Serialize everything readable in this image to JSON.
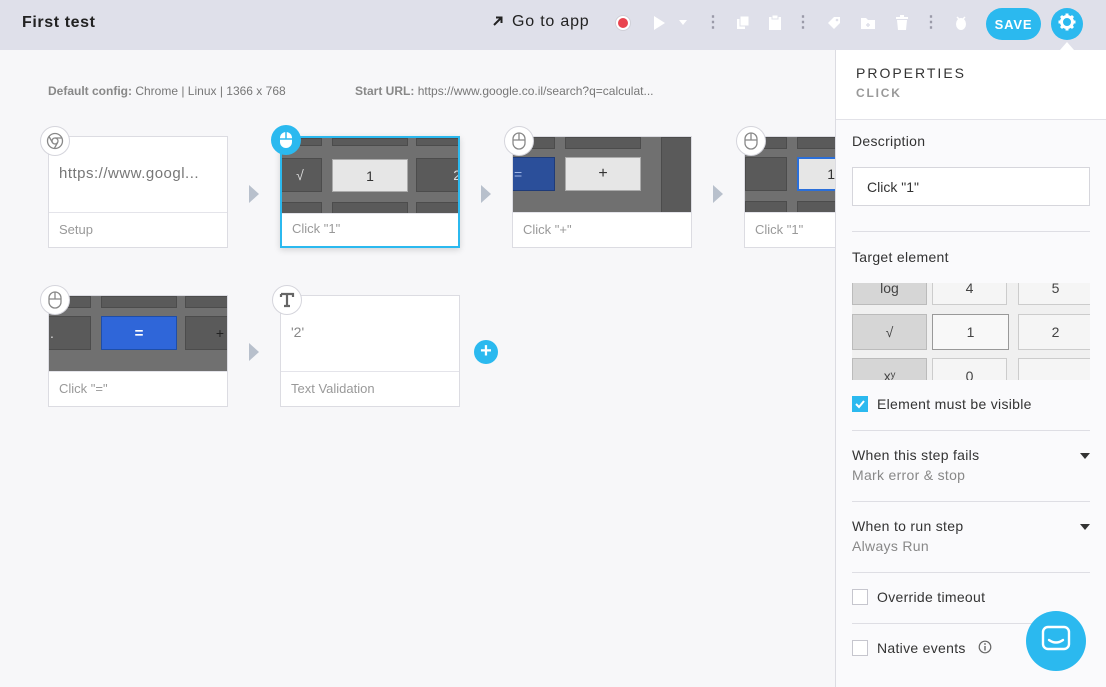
{
  "header": {
    "title": "First test",
    "go_to_app": "Go to app",
    "save_label": "SAVE",
    "icons": [
      "go-to-app-arrow-icon",
      "record-icon",
      "play-icon",
      "dropdown-caret-icon",
      "more-icon",
      "copy-icon",
      "paste-icon",
      "more-icon",
      "tag-icon",
      "add-folder-icon",
      "trash-icon",
      "more-icon",
      "bug-icon",
      "gear-icon"
    ]
  },
  "config": {
    "default_config_label": "Default config:",
    "default_config_value": "Chrome | Linux | 1366 x 768",
    "start_url_label": "Start URL:",
    "start_url_value": "https://www.google.co.il/search?q=calculat..."
  },
  "steps": [
    {
      "label": "Setup",
      "preview": "https://www.googl...",
      "icon": "chrome-icon"
    },
    {
      "label": "Click \"1\"",
      "key": "1",
      "icon": "mouse-icon",
      "selected": true
    },
    {
      "label": "Click \"+\"",
      "key": "+",
      "icon": "mouse-icon"
    },
    {
      "label": "Click \"1\"",
      "key": "1",
      "icon": "mouse-icon"
    },
    {
      "label": "Click \"=\"",
      "key": "=",
      "icon": "mouse-icon"
    },
    {
      "label": "Text Validation",
      "preview": "'2'",
      "icon": "text-icon"
    }
  ],
  "thumb_keys": {
    "sqrt": "√",
    "two": "2",
    "equals_left": "=",
    "dot": ".",
    "plus": "+"
  },
  "panel": {
    "title": "PROPERTIES",
    "subtitle": "CLICK",
    "description_label": "Description",
    "description_value": "Click \"1\"",
    "target_label": "Target element",
    "target_keys": {
      "log": "log",
      "four": "4",
      "five": "5",
      "sqrt": "√",
      "one": "1",
      "two": "2",
      "xy": "xʸ",
      "zero": "0"
    },
    "visible_label": "Element must be visible",
    "visible_checked": true,
    "fail_label": "When this step fails",
    "fail_value": "Mark error & stop",
    "run_label": "When to run step",
    "run_value": "Always Run",
    "timeout_label": "Override timeout",
    "timeout_checked": false,
    "native_label": "Native events",
    "native_checked": false
  },
  "colors": {
    "accent": "#2bb9ef",
    "record": "#e9434e",
    "topbar": "#dfe0ea"
  }
}
